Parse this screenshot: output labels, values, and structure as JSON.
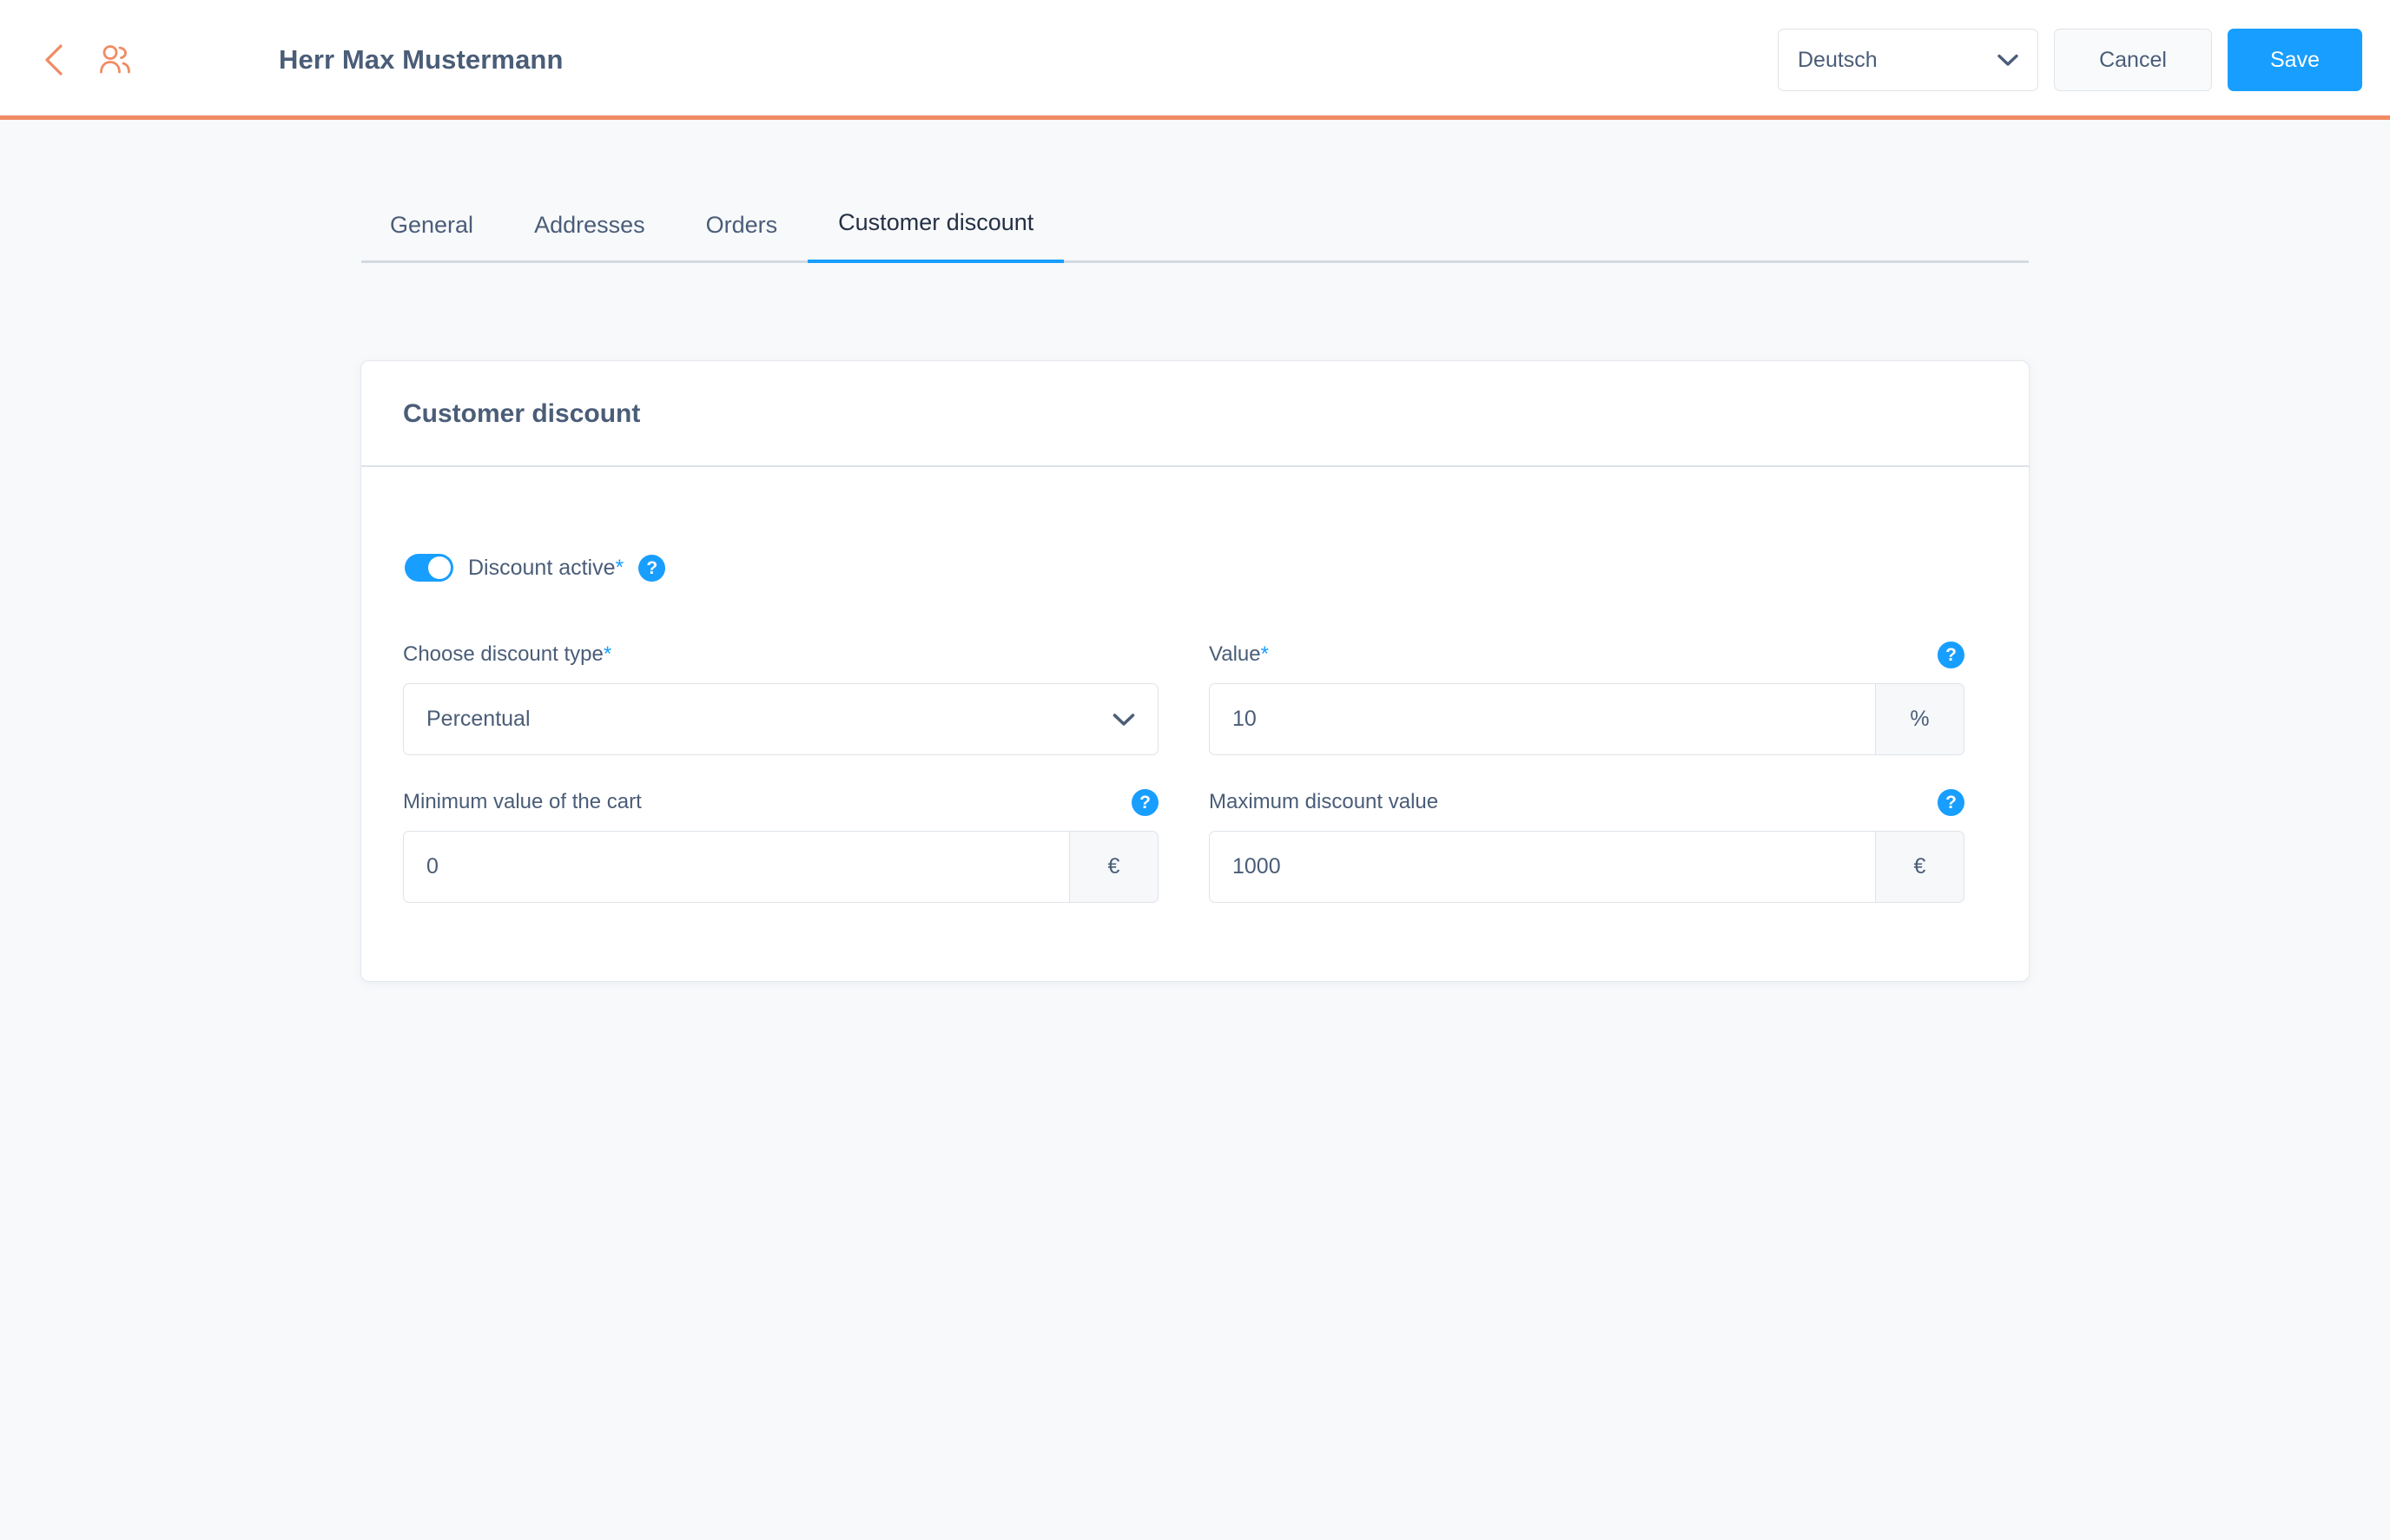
{
  "header": {
    "back_icon": "chevron-left-icon",
    "customers_icon": "users-icon",
    "title": "Herr Max Mustermann",
    "language": {
      "value": "Deutsch",
      "chevron_icon": "chevron-down-icon"
    },
    "cancel_label": "Cancel",
    "save_label": "Save",
    "accent_color": "#f08b63",
    "primary_color": "#189eff"
  },
  "tabs": [
    {
      "label": "General",
      "active": false
    },
    {
      "label": "Addresses",
      "active": false
    },
    {
      "label": "Orders",
      "active": false
    },
    {
      "label": "Customer discount",
      "active": true
    }
  ],
  "card": {
    "title": "Customer discount",
    "toggle": {
      "label": "Discount active",
      "required_marker": "*",
      "state": "on",
      "help_icon_label": "?"
    },
    "fields": {
      "discount_type": {
        "label": "Choose discount type",
        "required_marker": "*",
        "value": "Percentual",
        "chevron_icon": "chevron-down-icon"
      },
      "value": {
        "label": "Value",
        "required_marker": "*",
        "value": "10",
        "suffix": "%",
        "help_icon_label": "?"
      },
      "minimum_cart": {
        "label": "Minimum value of the cart",
        "value": "0",
        "suffix": "€",
        "help_icon_label": "?"
      },
      "maximum_discount": {
        "label": "Maximum discount value",
        "value": "1000",
        "suffix": "€",
        "help_icon_label": "?"
      }
    }
  }
}
